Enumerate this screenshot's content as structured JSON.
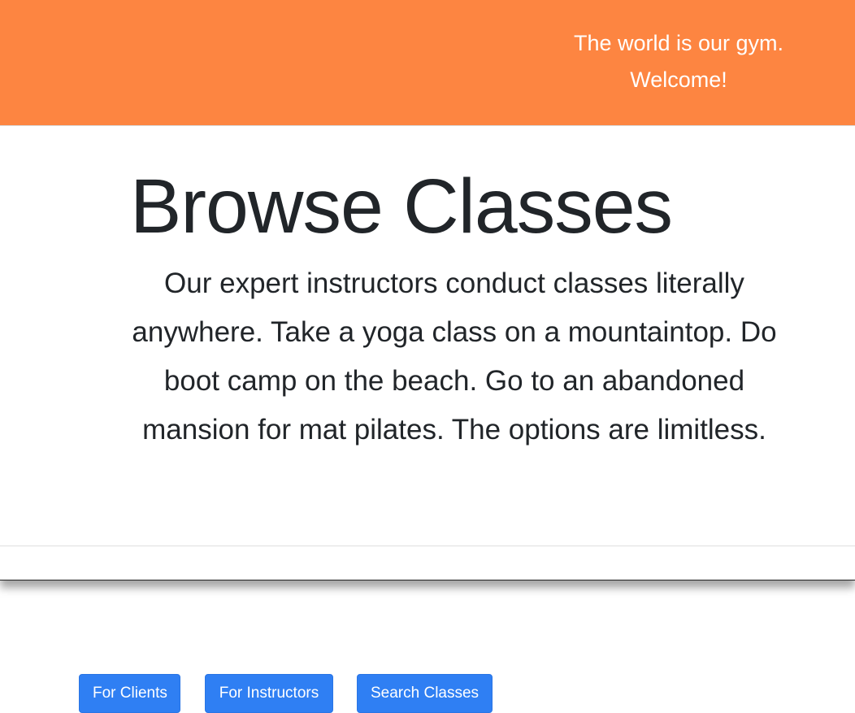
{
  "header": {
    "tagline_line1": "The world is our gym.",
    "tagline_line2": "Welcome!",
    "background_color": "#fd8541"
  },
  "hero": {
    "title": "Browse Classes",
    "description": "Our expert instructors conduct classes literally anywhere. Take a yoga class on a mountaintop. Do boot camp on the beach. Go to an abandoned mansion for mat pilates. The options are limitless."
  },
  "actions": {
    "for_clients": "For Clients",
    "for_instructors": "For Instructors",
    "search_classes": "Search Classes",
    "button_color": "#2f7ff3"
  }
}
